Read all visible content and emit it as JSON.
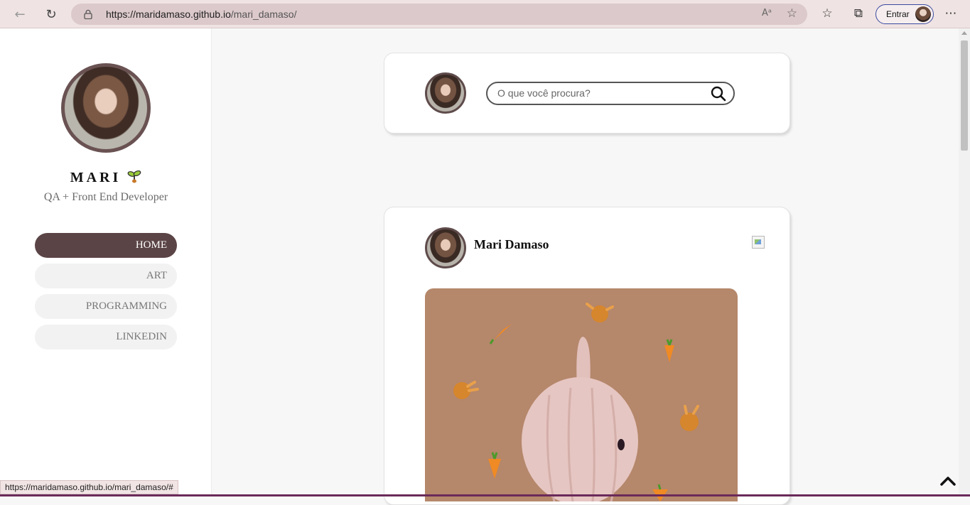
{
  "browser": {
    "url_host": "https://maridamaso.github.io",
    "url_path": "/mari_damaso/",
    "signin_label": "Entrar",
    "status_url": "https://maridamaso.github.io/mari_damaso/#"
  },
  "profile": {
    "name": "MARI",
    "role": "QA + Front End Developer"
  },
  "menu": [
    {
      "label": "HOME",
      "active": true
    },
    {
      "label": "ART",
      "active": false
    },
    {
      "label": "PROGRAMMING",
      "active": false
    },
    {
      "label": "LINKEDIN",
      "active": false
    }
  ],
  "search": {
    "placeholder": "O que você procura?"
  },
  "post": {
    "author": "Mari Damaso"
  },
  "colors": {
    "accent": "#5b4446",
    "image_bg": "#b5876b",
    "chrome": "#efe3e3"
  }
}
